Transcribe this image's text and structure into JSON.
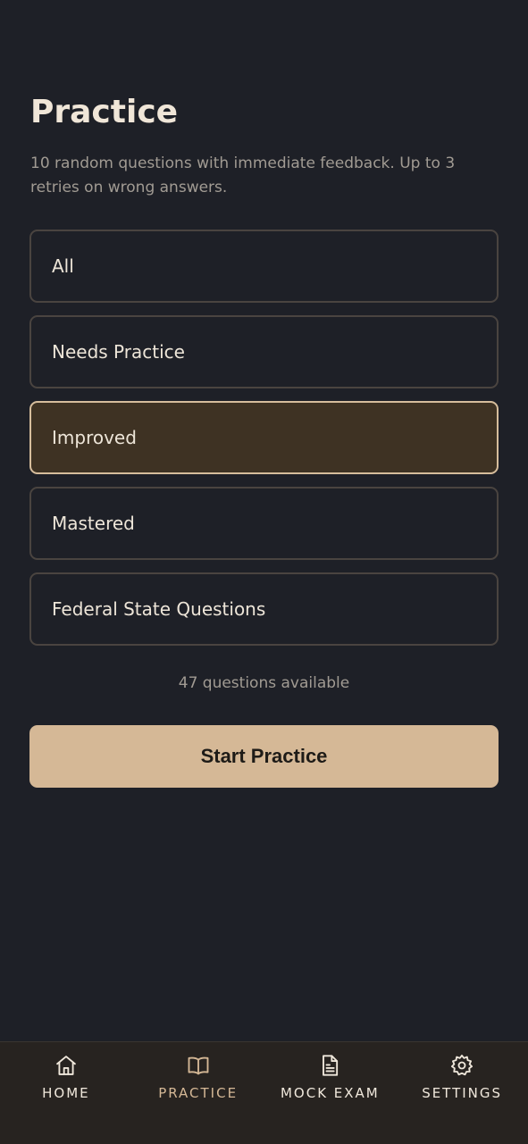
{
  "header": {
    "title": "Practice",
    "description": "10 random questions with immediate feedback. Up to 3 retries on wrong answers."
  },
  "filters": {
    "selected": "Improved",
    "options": [
      {
        "label": "All"
      },
      {
        "label": "Needs Practice"
      },
      {
        "label": "Improved"
      },
      {
        "label": "Mastered"
      },
      {
        "label": "Federal State Questions"
      }
    ]
  },
  "status": {
    "count_text": "47 questions available"
  },
  "actions": {
    "start_label": "Start Practice"
  },
  "nav": {
    "active": "PRACTICE",
    "items": [
      {
        "label": "HOME",
        "icon": "home-icon"
      },
      {
        "label": "PRACTICE",
        "icon": "book-icon"
      },
      {
        "label": "MOCK EXAM",
        "icon": "document-icon"
      },
      {
        "label": "SETTINGS",
        "icon": "gear-icon"
      }
    ]
  },
  "colors": {
    "background": "#1e2027",
    "accent": "#d5b896",
    "selected_fill": "#3e3223",
    "nav_background": "#272320"
  }
}
